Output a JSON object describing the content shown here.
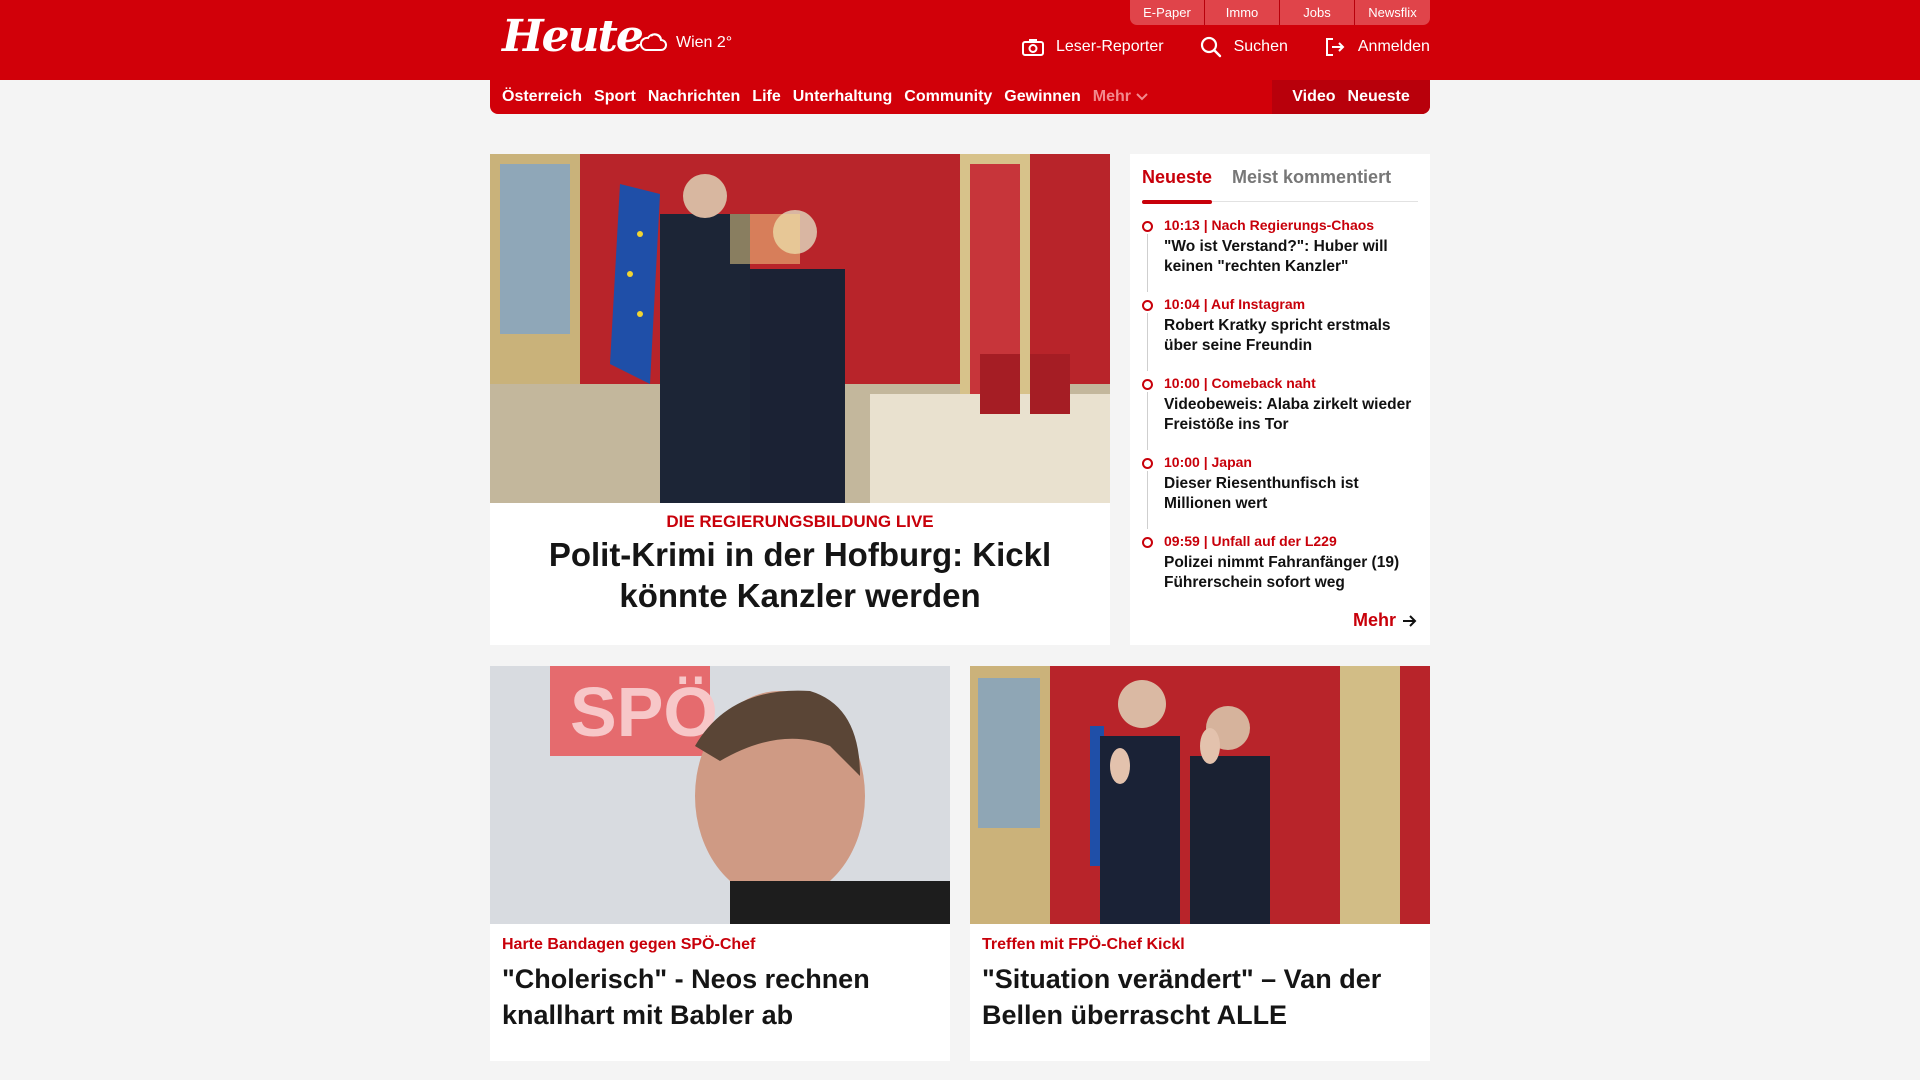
{
  "header": {
    "logo": "Heute",
    "weather": "Wien 2°",
    "top_tabs": [
      "E-Paper",
      "Immo",
      "Jobs",
      "Newsflix"
    ],
    "actions": {
      "reporter": "Leser-Reporter",
      "search": "Suchen",
      "login": "Anmelden"
    }
  },
  "nav": {
    "items": [
      "Österreich",
      "Sport",
      "Nachrichten",
      "Life",
      "Unterhaltung",
      "Community",
      "Gewinnen"
    ],
    "more": "Mehr",
    "right": [
      "Video",
      "Neueste"
    ]
  },
  "hero": {
    "kicker": "DIE REGIERUNGSBILDUNG LIVE",
    "title": "Polit-Krimi in der Hofburg: Kickl könnte Kanzler werden"
  },
  "sidebar": {
    "tabs": [
      "Neueste",
      "Meist kommentiert"
    ],
    "items": [
      {
        "meta": "10:13 | Nach Regierungs-Chaos",
        "title": "\"Wo ist Verstand?\": Huber will keinen \"rechten Kanzler\""
      },
      {
        "meta": "10:04 | Auf Instagram",
        "title": "Robert Kratky spricht erstmals über seine Freundin"
      },
      {
        "meta": "10:00 | Comeback naht",
        "title": "Videobeweis: Alaba zirkelt wieder Freistöße ins Tor"
      },
      {
        "meta": "10:00 | Japan",
        "title": "Dieser Riesenthunfisch ist Millionen wert"
      },
      {
        "meta": "09:59 | Unfall auf der L229",
        "title": "Polizei nimmt Fahranfänger (19) Führerschein sofort weg"
      }
    ],
    "more": "Mehr"
  },
  "cards": [
    {
      "kicker": "Harte Bandagen gegen SPÖ-Chef",
      "title": "\"Cholerisch\" - Neos rechnen knallhart mit Babler ab",
      "image_text": "SPÖ"
    },
    {
      "kicker": "Treffen mit FPÖ-Chef Kickl",
      "title": "\"Situation verändert\" – Van der Bellen überrascht ALLE"
    }
  ],
  "colors": {
    "brand": "#d10009",
    "accent": "#c8000a",
    "nav_dark": "#b8000b"
  },
  "icons": [
    "cloud-icon",
    "camera-icon",
    "search-icon",
    "login-icon",
    "chevron-down-icon",
    "arrow-right-icon"
  ]
}
